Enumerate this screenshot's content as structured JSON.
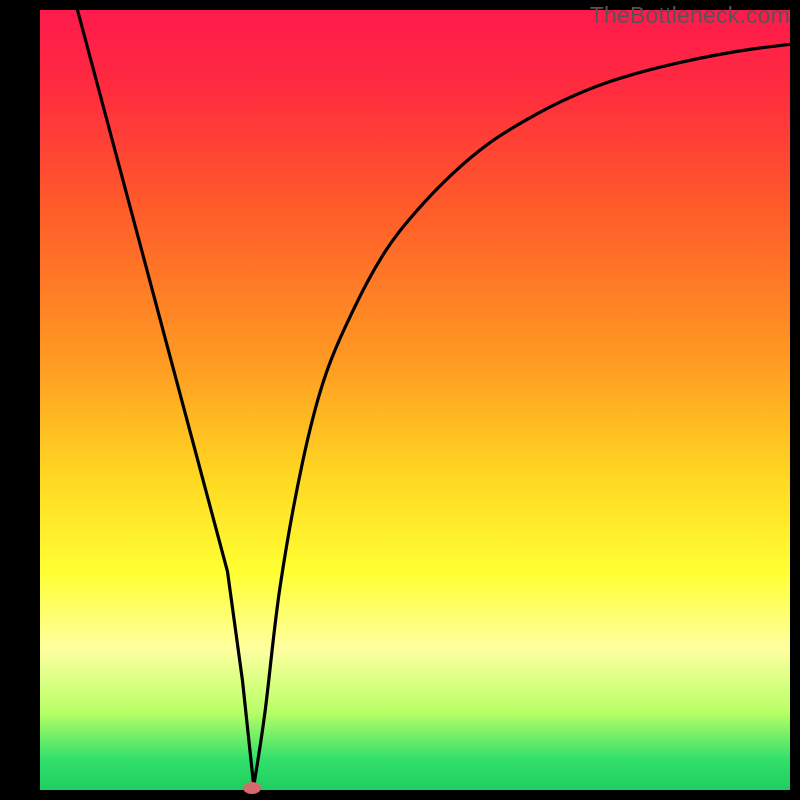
{
  "watermark": "TheBottleneck.com",
  "chart_data": {
    "type": "line",
    "title": "",
    "xlabel": "",
    "ylabel": "",
    "xlim": [
      0,
      100
    ],
    "ylim": [
      0,
      100
    ],
    "grid": false,
    "legend": false,
    "gradient_stops": [
      {
        "offset": 0,
        "color": "#ff1a4d"
      },
      {
        "offset": 10,
        "color": "#ff2b3f"
      },
      {
        "offset": 25,
        "color": "#ff5a2a"
      },
      {
        "offset": 45,
        "color": "#ff9a22"
      },
      {
        "offset": 60,
        "color": "#ffd822"
      },
      {
        "offset": 72,
        "color": "#ffff33"
      },
      {
        "offset": 82,
        "color": "#feffa0"
      },
      {
        "offset": 90,
        "color": "#b8ff66"
      },
      {
        "offset": 96,
        "color": "#33e06b"
      },
      {
        "offset": 100,
        "color": "#1fce62"
      }
    ],
    "series": [
      {
        "name": "curve",
        "x": [
          5,
          10,
          15,
          20,
          25,
          27,
          28.5,
          30,
          32,
          35,
          38,
          42,
          46,
          50,
          55,
          60,
          65,
          70,
          75,
          80,
          85,
          90,
          95,
          100
        ],
        "y": [
          100,
          82,
          64,
          46,
          28,
          14,
          0.5,
          10,
          26,
          42,
          53,
          62,
          69,
          74,
          79,
          83,
          86,
          88.5,
          90.5,
          92,
          93.2,
          94.2,
          95,
          95.6
        ]
      }
    ],
    "marker": {
      "x": 28.3,
      "y": 0.3,
      "color": "#d46a6a"
    }
  }
}
